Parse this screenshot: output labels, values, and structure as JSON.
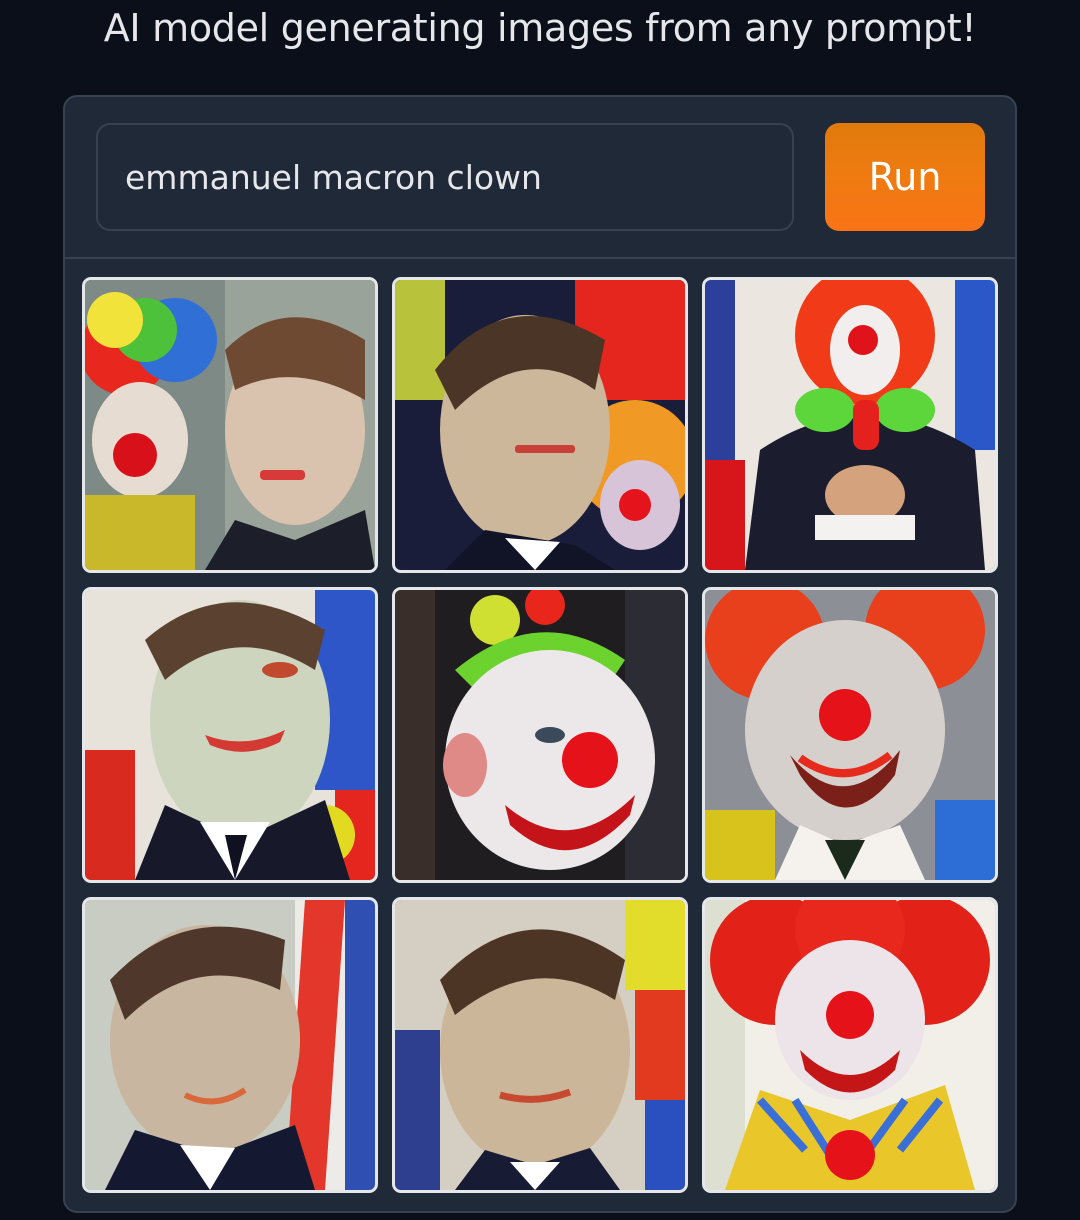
{
  "header": {
    "subtitle": "AI model generating images from any prompt!"
  },
  "prompt": {
    "value": "emmanuel macron clown"
  },
  "run_button": {
    "label": "Run",
    "color": "#f97316"
  },
  "gallery": {
    "count": 9,
    "border_color": "#e5e7eb"
  },
  "colors": {
    "background": "#0b0f19",
    "panel": "#1f2937",
    "border": "#374151",
    "text": "#e5e7eb"
  }
}
